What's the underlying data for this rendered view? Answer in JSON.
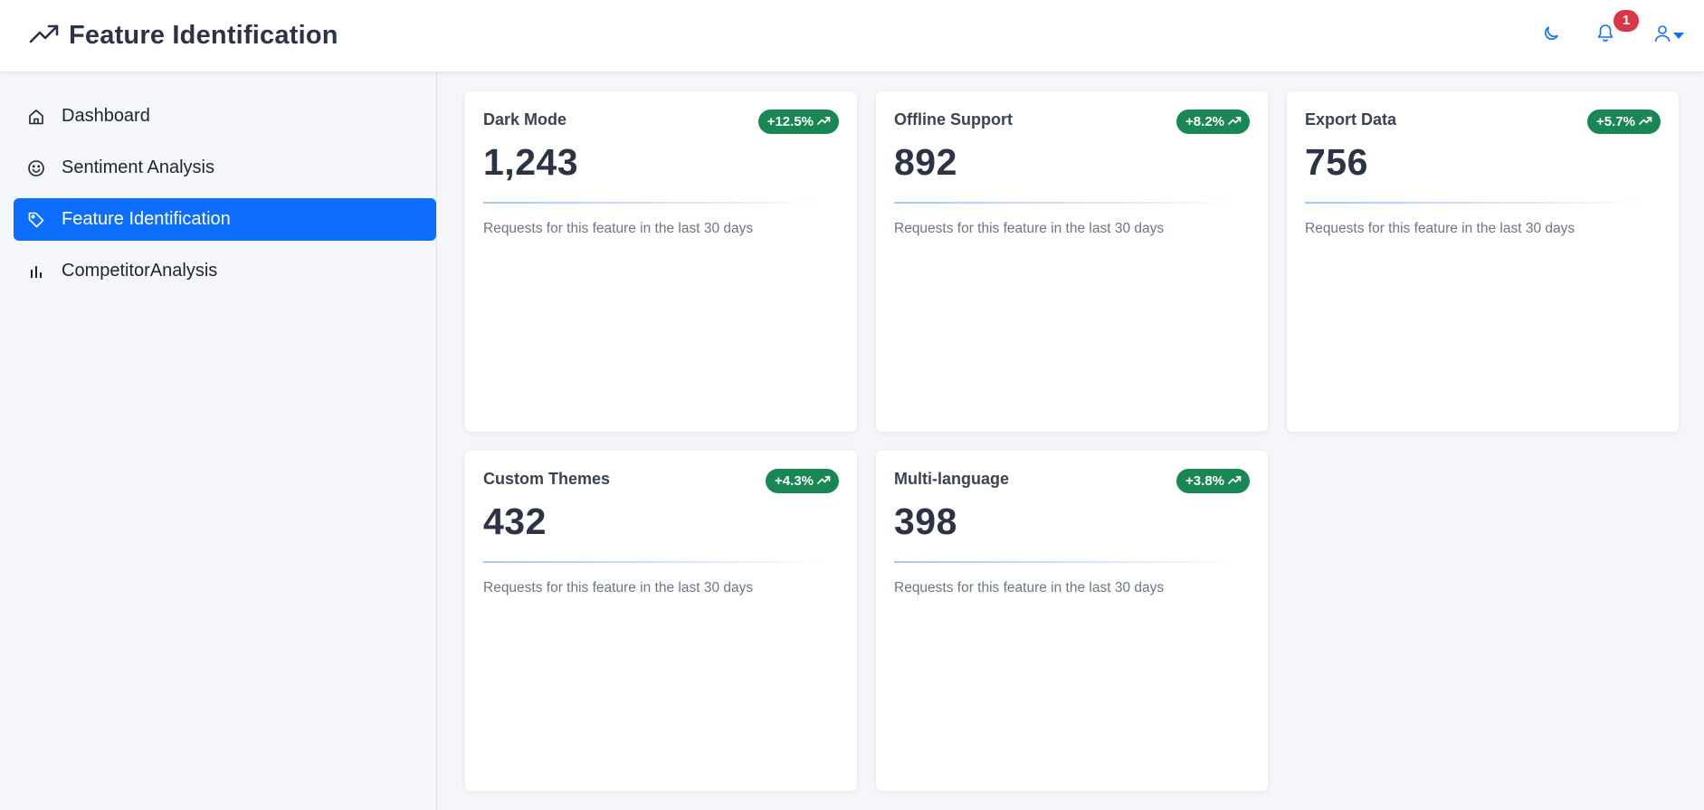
{
  "header": {
    "title": "Feature Identification",
    "brand_icon": "trending-up-icon",
    "notification_count": "1"
  },
  "sidebar": {
    "items": [
      {
        "label": "Dashboard",
        "icon": "home-icon",
        "active": false
      },
      {
        "label": "Sentiment Analysis",
        "icon": "smile-icon",
        "active": false
      },
      {
        "label": "Feature Identification",
        "icon": "tag-icon",
        "active": true
      },
      {
        "label": "CompetitorAnalysis",
        "icon": "bar-chart-icon",
        "active": false
      }
    ]
  },
  "cards": [
    {
      "name": "Dark Mode",
      "count": "1,243",
      "change": "+12.5%",
      "description": "Requests for this feature in the last 30 days"
    },
    {
      "name": "Offline Support",
      "count": "892",
      "change": "+8.2%",
      "description": "Requests for this feature in the last 30 days"
    },
    {
      "name": "Export Data",
      "count": "756",
      "change": "+5.7%",
      "description": "Requests for this feature in the last 30 days"
    },
    {
      "name": "Custom Themes",
      "count": "432",
      "change": "+4.3%",
      "description": "Requests for this feature in the last 30 days"
    },
    {
      "name": "Multi-language",
      "count": "398",
      "change": "+3.8%",
      "description": "Requests for this feature in the last 30 days"
    }
  ],
  "colors": {
    "accent": "#0d6efd",
    "positive": "#198754",
    "badge": "#dc3545"
  }
}
